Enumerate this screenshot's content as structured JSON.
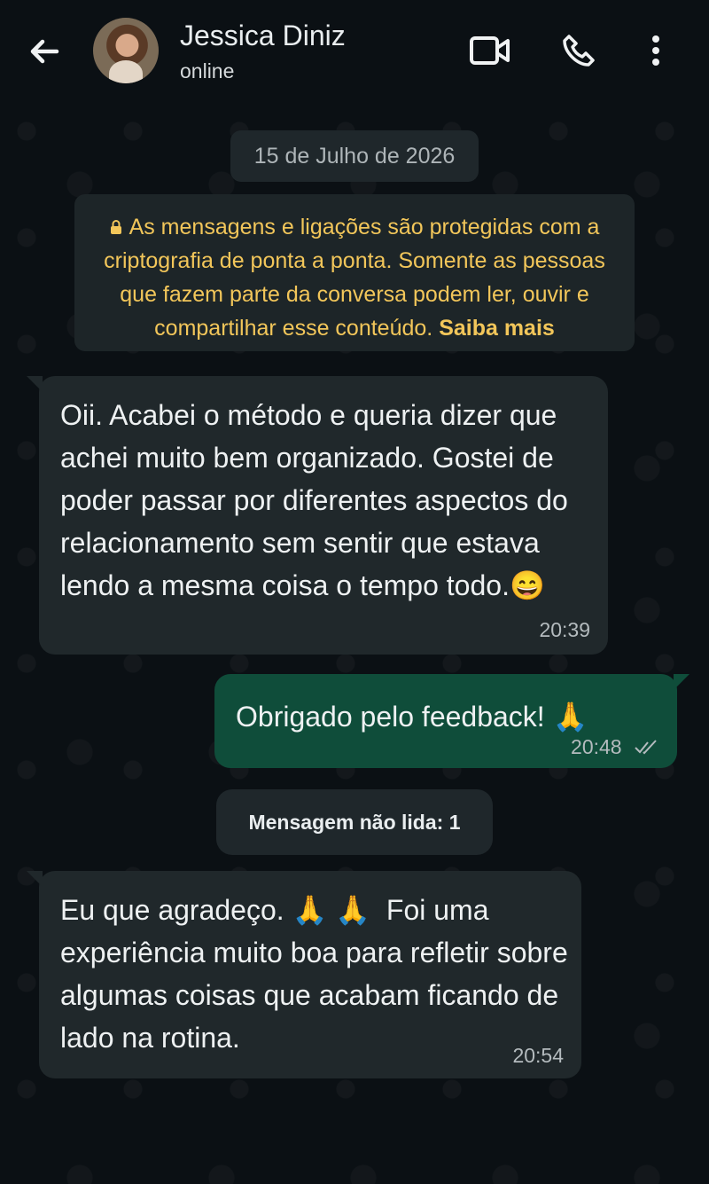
{
  "header": {
    "contact_name": "Jessica Diniz",
    "status": "online",
    "icons": {
      "back": "arrow-left-icon",
      "video": "video-camera-icon",
      "call": "phone-icon",
      "menu": "vertical-dots-icon"
    }
  },
  "chat": {
    "date_chip": "15 de Julho de 2026",
    "encryption_notice": {
      "text": "As mensagens e ligações são protegidas com a criptografia de ponta a ponta. Somente as pessoas que fazem parte da conversa podem ler, ouvir e compartilhar esse conteúdo. ",
      "link": "Saiba mais",
      "icon": "lock-icon"
    },
    "messages": [
      {
        "direction": "incoming",
        "text": "Oii. Acabei o método e queria dizer que achei muito bem organizado. Gostei de poder passar por diferentes aspectos do relacionamento sem sentir que estava lendo a mesma coisa o tempo todo.",
        "emoji": "😄",
        "time": "20:39"
      },
      {
        "direction": "outgoing",
        "text": "Obrigado pelo feedback!",
        "emoji": "🙏",
        "time": "20:48",
        "status_icon": "double-check-icon"
      },
      {
        "direction": "incoming",
        "text": "Eu que agradeço. 🙏 🙏  Foi uma experiência muito boa para refletir sobre algumas coisas que acabam ficando de lado na rotina.",
        "time": "20:54"
      }
    ],
    "unread_label": "Mensagem não lida: 1"
  },
  "colors": {
    "background": "#0b1014",
    "incoming_bubble": "#20282b",
    "outgoing_bubble": "#0f4d3a",
    "notice_text": "#f2c65a"
  }
}
